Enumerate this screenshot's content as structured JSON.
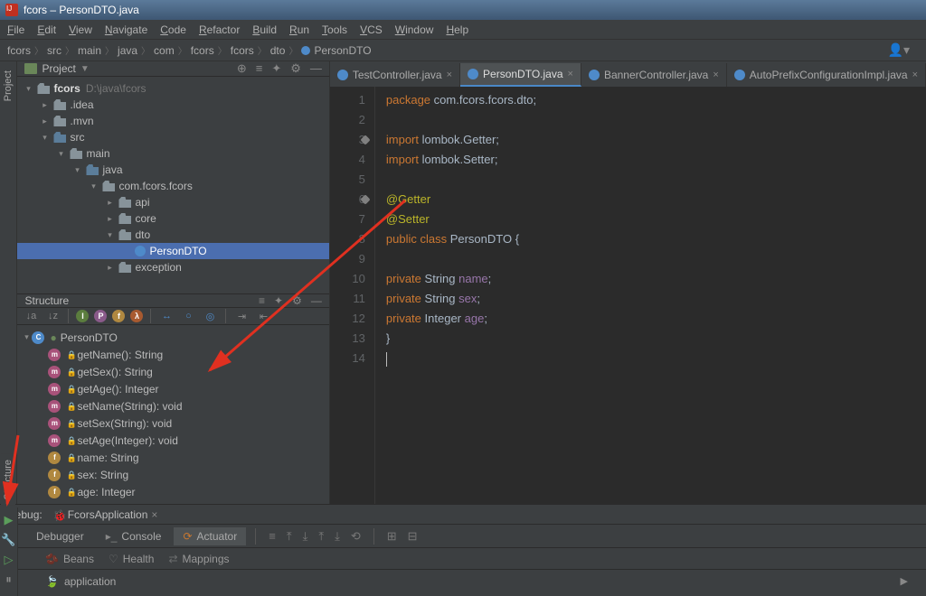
{
  "title": "fcors – PersonDTO.java",
  "menu": [
    "File",
    "Edit",
    "View",
    "Navigate",
    "Code",
    "Refactor",
    "Build",
    "Run",
    "Tools",
    "VCS",
    "Window",
    "Help"
  ],
  "menu_underline": [
    "F",
    "E",
    "V",
    "N",
    "C",
    "R",
    "B",
    "R",
    "T",
    "V",
    "W",
    "H"
  ],
  "breadcrumbs": [
    "fcors",
    "src",
    "main",
    "java",
    "com",
    "fcors",
    "fcors",
    "dto",
    "PersonDTO"
  ],
  "project": {
    "label": "Project",
    "root": {
      "name": "fcors",
      "path": "D:\\java\\fcors"
    },
    "tree": [
      {
        "name": ".idea",
        "depth": 1,
        "arrow": ">",
        "type": "folder"
      },
      {
        "name": ".mvn",
        "depth": 1,
        "arrow": ">",
        "type": "folder"
      },
      {
        "name": "src",
        "depth": 1,
        "arrow": "v",
        "type": "folder-blue"
      },
      {
        "name": "main",
        "depth": 2,
        "arrow": "v",
        "type": "folder"
      },
      {
        "name": "java",
        "depth": 3,
        "arrow": "v",
        "type": "folder-blue"
      },
      {
        "name": "com.fcors.fcors",
        "depth": 4,
        "arrow": "v",
        "type": "package"
      },
      {
        "name": "api",
        "depth": 5,
        "arrow": ">",
        "type": "package"
      },
      {
        "name": "core",
        "depth": 5,
        "arrow": ">",
        "type": "package"
      },
      {
        "name": "dto",
        "depth": 5,
        "arrow": "v",
        "type": "package"
      },
      {
        "name": "PersonDTO",
        "depth": 6,
        "arrow": "",
        "type": "class",
        "selected": true
      },
      {
        "name": "exception",
        "depth": 5,
        "arrow": ">",
        "type": "package"
      }
    ]
  },
  "structure": {
    "label": "Structure",
    "class": "PersonDTO",
    "members": [
      {
        "icon": "method",
        "lock": true,
        "sig": "getName(): String"
      },
      {
        "icon": "method",
        "lock": true,
        "sig": "getSex(): String"
      },
      {
        "icon": "method",
        "lock": true,
        "sig": "getAge(): Integer"
      },
      {
        "icon": "method",
        "lock": true,
        "sig": "setName(String): void"
      },
      {
        "icon": "method",
        "lock": true,
        "sig": "setSex(String): void"
      },
      {
        "icon": "method",
        "lock": true,
        "sig": "setAge(Integer): void"
      },
      {
        "icon": "field",
        "lock": true,
        "sig": "name: String"
      },
      {
        "icon": "field",
        "lock": true,
        "sig": "sex: String"
      },
      {
        "icon": "field",
        "lock": true,
        "sig": "age: Integer"
      }
    ]
  },
  "tabs": [
    {
      "label": "TestController.java",
      "active": false
    },
    {
      "label": "PersonDTO.java",
      "active": true
    },
    {
      "label": "BannerController.java",
      "active": false
    },
    {
      "label": "AutoPrefixConfigurationImpl.java",
      "active": false
    }
  ],
  "code": {
    "lines": [
      {
        "n": 1,
        "html": "<span class='kw'>package</span> <span class='pkg'>com.fcors.fcors.dto</span>;"
      },
      {
        "n": 2,
        "html": ""
      },
      {
        "n": 3,
        "html": "<span class='kw'>import</span> <span class='pkg'>lombok.Getter</span>;",
        "mark": true
      },
      {
        "n": 4,
        "html": "<span class='kw'>import</span> <span class='pkg'>lombok.Setter</span>;"
      },
      {
        "n": 5,
        "html": ""
      },
      {
        "n": 6,
        "html": "<span class='ann'>@Getter</span>",
        "mark": true
      },
      {
        "n": 7,
        "html": "<span class='ann'>@Setter</span>"
      },
      {
        "n": 8,
        "html": "<span class='kw'>public class</span> <span class='cls'>PersonDTO</span> {"
      },
      {
        "n": 9,
        "html": ""
      },
      {
        "n": 10,
        "html": "    <span class='kw'>private</span> <span class='typ'>String</span> <span class='fld-n'>name</span>;"
      },
      {
        "n": 11,
        "html": "    <span class='kw'>private</span> <span class='typ'>String</span> <span class='fld-n'>sex</span>;"
      },
      {
        "n": 12,
        "html": "    <span class='kw'>private</span> <span class='typ'>Integer</span> <span class='fld-n'>age</span>;"
      },
      {
        "n": 13,
        "html": "}"
      },
      {
        "n": 14,
        "html": "<span class='caret'></span>"
      }
    ]
  },
  "debug": {
    "label": "Debug:",
    "app": "FcorsApplication",
    "tabs": [
      "Debugger",
      "Console",
      "Actuator"
    ],
    "subtabs": [
      "Beans",
      "Health",
      "Mappings"
    ],
    "node": "application"
  },
  "sidetabs": {
    "project": "Project",
    "structure": "Structure"
  }
}
